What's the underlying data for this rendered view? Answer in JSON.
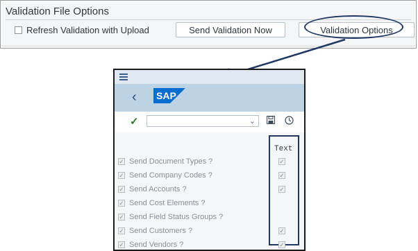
{
  "top_panel": {
    "title": "Validation File Options",
    "refresh_label": "Refresh Validation with Upload",
    "send_button": "Send Validation Now",
    "options_button": "Validation Options"
  },
  "sap": {
    "logo_text": "SAP",
    "select_value": "",
    "text_column_header": "Text",
    "options": [
      {
        "label": "Send Document Types ?",
        "checked": true,
        "text_checked": true
      },
      {
        "label": "Send Company Codes ?",
        "checked": true,
        "text_checked": true
      },
      {
        "label": "Send Accounts ?",
        "checked": true,
        "text_checked": true
      },
      {
        "label": "Send Cost Elements ?",
        "checked": true,
        "text_checked": false
      },
      {
        "label": "Send Field Status Groups ?",
        "checked": true,
        "text_checked": false
      },
      {
        "label": "Send Customers ?",
        "checked": true,
        "text_checked": true
      },
      {
        "label": "Send Vendors ?",
        "checked": true,
        "text_checked": true
      }
    ]
  },
  "colors": {
    "annotation": "#1f3864",
    "sap_header": "#bcd3e6",
    "sap_logo": "#0a6ed1"
  },
  "icons": [
    "hamburger-icon",
    "back-icon",
    "sap-logo",
    "check-icon",
    "chevron-down-icon",
    "save-icon",
    "clock-icon"
  ]
}
